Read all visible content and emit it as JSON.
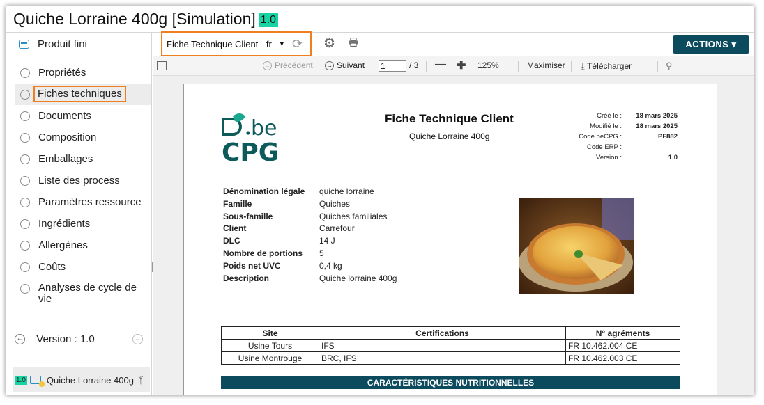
{
  "header": {
    "title": "Quiche Lorraine 400g [Simulation]",
    "version_badge": "1.0"
  },
  "sidebar": {
    "section_title": "Produit fini",
    "items": [
      {
        "label": "Propriétés"
      },
      {
        "label": "Fiches techniques",
        "active": true
      },
      {
        "label": "Documents"
      },
      {
        "label": "Composition"
      },
      {
        "label": "Emballages"
      },
      {
        "label": "Liste des process"
      },
      {
        "label": "Paramètres ressource"
      },
      {
        "label": "Ingrédients"
      },
      {
        "label": "Allergènes"
      },
      {
        "label": "Coûts"
      },
      {
        "label": "Analyses de cycle de vie"
      }
    ],
    "version_label": "Version : 1.0",
    "product": {
      "badge": "1.0",
      "name": "Quiche Lorraine 400g"
    }
  },
  "toolbar": {
    "report_select": "Fiche Technique Client - fr",
    "actions_label": "ACTIONS ▾"
  },
  "viewer": {
    "prev_label": "Précédent",
    "next_label": "Suivant",
    "page_value": "1",
    "page_total": "/ 3",
    "zoom": "125%",
    "maximize_label": "Maximiser",
    "download_label": "Télécharger"
  },
  "document": {
    "title": "Fiche Technique Client",
    "subtitle": "Quiche Lorraine 400g",
    "logo_text": "beCPG",
    "meta": [
      {
        "k": "Créé le :",
        "v": "18 mars 2025"
      },
      {
        "k": "Modifié le :",
        "v": "18 mars 2025"
      },
      {
        "k": "Code beCPG :",
        "v": "PF882"
      },
      {
        "k": "Code ERP :",
        "v": ""
      },
      {
        "k": "Version :",
        "v": "1.0"
      }
    ],
    "properties": [
      {
        "k": "Dénomination légale",
        "v": "quiche lorraine"
      },
      {
        "k": "Famille",
        "v": "Quiches"
      },
      {
        "k": "Sous-famille",
        "v": "Quiches familiales"
      },
      {
        "k": "Client",
        "v": "Carrefour"
      },
      {
        "k": "DLC",
        "v": "14 J"
      },
      {
        "k": "Nombre de portions",
        "v": "5"
      },
      {
        "k": "Poids net UVC",
        "v": "0,4 kg"
      },
      {
        "k": "Description",
        "v": "Quiche lorraine 400g"
      }
    ],
    "sites_table": {
      "headers": [
        "Site",
        "Certifications",
        "N° agréments"
      ],
      "rows": [
        [
          "Usine Tours",
          "IFS",
          "FR 10.462.004 CE"
        ],
        [
          "Usine Montrouge",
          "BRC, IFS",
          "FR 10.462.003 CE"
        ]
      ]
    },
    "section_header": "CARACTÉRISTIQUES NUTRITIONNELLES"
  },
  "colors": {
    "accent": "#0c4a5e",
    "highlight": "#f07d1e",
    "badge": "#19d3a2",
    "icon_blue": "#2a8fc7"
  }
}
